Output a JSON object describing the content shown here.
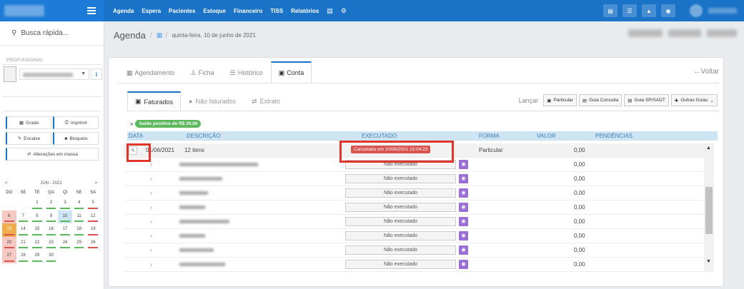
{
  "topbar": {
    "logo_text": "Negrai",
    "nav": [
      "Agenda",
      "Espera",
      "Pacientes",
      "Estoque",
      "Financeiro",
      "TISS",
      "Relatórios"
    ],
    "nav_icons": [
      "database-icon",
      "gear-icon"
    ],
    "right_icons": [
      "inbox-icon",
      "list-icon",
      "bell-icon",
      "chat-icon"
    ]
  },
  "sidebar": {
    "search_label": "Busca rápida...",
    "profissional_label": "PROFISSIONAL",
    "buttons": {
      "grade": "Grade",
      "imprimir": "Imprimir",
      "encaixe": "Encaixe",
      "bloqueio": "Bloqueio",
      "alteracoes": "Alterações em massa"
    },
    "calendar": {
      "month": "JUN - 2021",
      "prev": "<",
      "next": ">",
      "dows": [
        "DO",
        "SE",
        "TE",
        "QA",
        "QI",
        "SE",
        "SA"
      ],
      "days": [
        "",
        "",
        "1",
        "2",
        "3",
        "4",
        "5",
        "6",
        "7",
        "8",
        "9",
        "10",
        "11",
        "12",
        "13",
        "14",
        "15",
        "16",
        "17",
        "18",
        "19",
        "20",
        "21",
        "22",
        "23",
        "24",
        "25",
        "26",
        "27",
        "28",
        "29",
        "30"
      ],
      "today": "13",
      "selected": "10"
    }
  },
  "header": {
    "title": "Agenda",
    "date": "quinta-feira, 10 de junho de 2021"
  },
  "tabs_main": [
    {
      "label": "Agendamento",
      "icon": "calendar-icon"
    },
    {
      "label": "Ficha",
      "icon": "user-icon"
    },
    {
      "label": "Histórico",
      "icon": "list-icon"
    },
    {
      "label": "Conta",
      "icon": "money-icon"
    }
  ],
  "voltar_label": "Voltar",
  "tabs_sub": [
    {
      "label": "Faturados",
      "icon": "money-icon"
    },
    {
      "label": "Não faturados",
      "icon": "info-icon"
    },
    {
      "label": "Extrato",
      "icon": "exchange-icon"
    }
  ],
  "lancar": {
    "label": "Lançar",
    "buttons": [
      "Particular",
      "Guia Consulta",
      "Guia SP/SADT",
      "Outras Guias"
    ]
  },
  "saldo": "Saldo positivo de R$ 29,00",
  "table": {
    "columns": [
      "DATA",
      "DESCRIÇÃO",
      "EXECUTADO",
      "FORMA",
      "VALOR",
      "PENDÊNCIAS"
    ],
    "first_row": {
      "date": "01/06/2021",
      "desc": "12 itens",
      "executed": "Cancelada em 10/06/2021 15:04:23",
      "forma": "Particular",
      "valor": "0,00"
    },
    "item_rows": [
      {
        "executed": "Não executado",
        "valor": "0,00"
      },
      {
        "executed": "Não executado",
        "valor": "0,00"
      },
      {
        "executed": "Não executado",
        "valor": "0,00"
      },
      {
        "executed": "Não executado",
        "valor": "0,00"
      },
      {
        "executed": "Não executado",
        "valor": "0,00"
      },
      {
        "executed": "Não executado",
        "valor": "0,00"
      },
      {
        "executed": "Não executado",
        "valor": "0,00"
      },
      {
        "executed": "Não executado",
        "valor": "0,00"
      }
    ]
  },
  "colors": {
    "brand": "#1a73c7",
    "success": "#5cb85c",
    "danger": "#d9534f",
    "highlight_box": "#e0352b",
    "camera": "#9b6fd3"
  }
}
